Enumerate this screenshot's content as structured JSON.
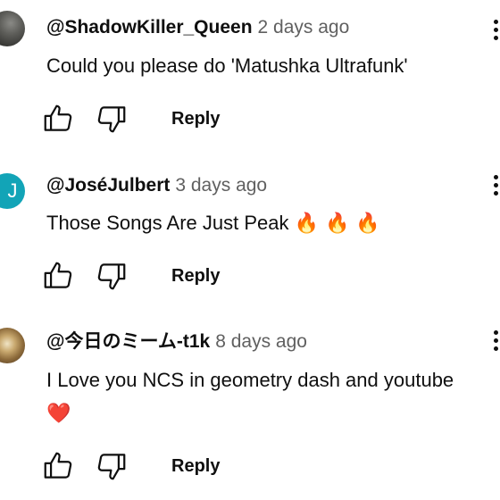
{
  "comments": [
    {
      "handle": "@ShadowKiller_Queen",
      "time": "2 days ago",
      "text": "Could you please do 'Matushka Ultrafunk'",
      "avatar": "dark-photo",
      "reply_label": "Reply"
    },
    {
      "handle": "@JoséJulbert",
      "time": "3 days ago",
      "text": "Those Songs Are Just Peak",
      "emoji": "🔥 🔥 🔥",
      "avatar_letter": "J",
      "avatar_color": "#12a4b7",
      "reply_label": "Reply"
    },
    {
      "handle": "@今日のミーム-t1k",
      "time": "8 days ago",
      "text": "I Love you NCS in geometry dash and youtube",
      "emoji_line": "❤️",
      "avatar": "dog-photo",
      "reply_label": "Reply"
    }
  ],
  "icons": {
    "like": "thumbs-up-icon",
    "dislike": "thumbs-down-icon",
    "more": "more-vert-icon"
  },
  "colors": {
    "text": "#0f0f0f",
    "secondary": "#606060",
    "fire": "#ff6a00",
    "heart": "#e52d27"
  }
}
